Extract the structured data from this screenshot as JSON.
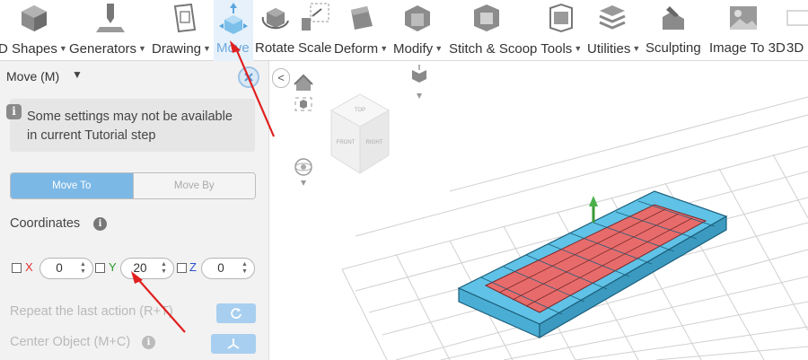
{
  "toolbar": {
    "menus": [
      {
        "label": "D Shapes",
        "has_caret": true
      },
      {
        "label": "Generators",
        "has_caret": true
      },
      {
        "label": "Drawing",
        "has_caret": true
      },
      {
        "label": "Move",
        "has_caret": false,
        "active": true
      },
      {
        "label": "Rotate",
        "has_caret": false
      },
      {
        "label": "Scale",
        "has_caret": false
      },
      {
        "label": "Deform",
        "has_caret": true
      },
      {
        "label": "Modify",
        "has_caret": true
      },
      {
        "label": "Stitch & Scoop Tools",
        "has_caret": true
      },
      {
        "label": "Utilities",
        "has_caret": true
      },
      {
        "label": "Sculpting",
        "has_caret": false
      },
      {
        "label": "Image To 3D",
        "has_caret": false
      },
      {
        "label": "3D",
        "has_caret": false
      }
    ]
  },
  "panel": {
    "title": "Move (M)",
    "title_caret": "▼",
    "close_icon": "close-icon",
    "info_badge": "i",
    "info_text": "Some settings may not be available in current Tutorial step",
    "seg_move_to": "Move To",
    "seg_move_by": "Move By",
    "coordinates_label": "Coordinates",
    "coord_info": "i",
    "x_label": "X",
    "y_label": "Y",
    "z_label": "Z",
    "x_value": "0",
    "y_value": "20",
    "z_value": "0",
    "repeat_label": "Repeat the last action (R+T)",
    "center_label": "Center Object (M+C)",
    "center_info": "i"
  },
  "viewport": {
    "collapse_glyph": "<",
    "cube_faces": {
      "top": "TOP",
      "front": "FRONT",
      "right": "RIGHT"
    },
    "colors": {
      "grid": "#d0d0d0",
      "object_blue": "#5fc2e6",
      "object_red": "#e86b6b",
      "accent": "#6fa8dc",
      "annotation": "#e02020"
    }
  }
}
